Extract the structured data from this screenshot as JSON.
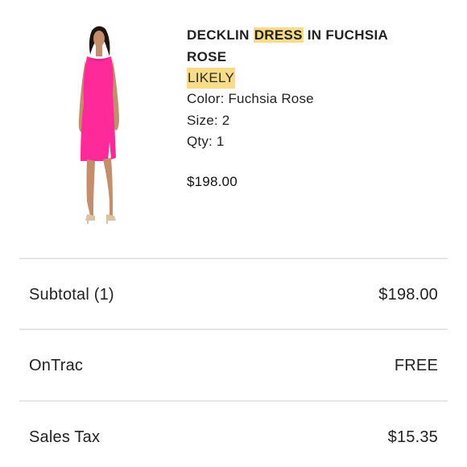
{
  "product": {
    "title_pre": "DECKLIN ",
    "title_highlight": "DRESS",
    "title_post": " IN FUCHSIA ROSE",
    "brand": "LIKELY",
    "color": "Color: Fuchsia Rose",
    "size": "Size: 2",
    "qty": "Qty: 1",
    "price": "$198.00",
    "dress_color": "#ff2a9a"
  },
  "summary": [
    {
      "label": "Subtotal (1)",
      "value": "$198.00"
    },
    {
      "label": "OnTrac",
      "value": "FREE"
    },
    {
      "label": "Sales Tax",
      "value": "$15.35"
    }
  ]
}
